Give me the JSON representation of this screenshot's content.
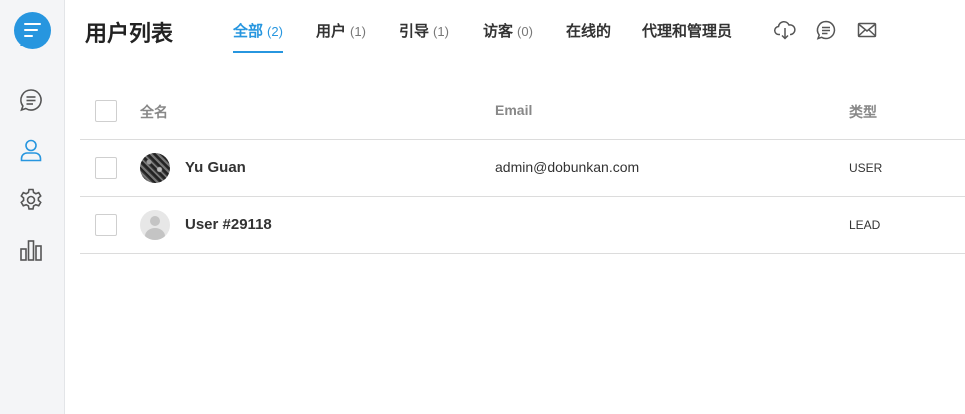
{
  "sidebar": {
    "logo": "chat-bubble-logo",
    "items": [
      {
        "name": "conversations",
        "icon": "chat-icon"
      },
      {
        "name": "users",
        "icon": "user-icon",
        "active": true
      },
      {
        "name": "settings",
        "icon": "gear-icon"
      },
      {
        "name": "reports",
        "icon": "bar-chart-icon"
      }
    ]
  },
  "header": {
    "title": "用户列表",
    "tabs": [
      {
        "label": "全部",
        "count": "(2)",
        "active": true
      },
      {
        "label": "用户",
        "count": "(1)"
      },
      {
        "label": "引导",
        "count": "(1)"
      },
      {
        "label": "访客",
        "count": "(0)"
      },
      {
        "label": "在线的",
        "count": ""
      },
      {
        "label": "代理和管理员",
        "count": ""
      }
    ],
    "actions": [
      {
        "name": "download",
        "icon": "cloud-download-icon"
      },
      {
        "name": "message",
        "icon": "chat-icon"
      },
      {
        "name": "email",
        "icon": "mail-icon"
      }
    ]
  },
  "table": {
    "columns": [
      "全名",
      "Email",
      "类型"
    ],
    "rows": [
      {
        "name": "Yu Guan",
        "email": "admin@dobunkan.com",
        "type": "USER",
        "avatar": "photo"
      },
      {
        "name": "User #29118",
        "email": "",
        "type": "LEAD",
        "avatar": "placeholder"
      }
    ]
  },
  "colors": {
    "accent": "#2796df",
    "icon": "#555555",
    "sidebar_bg": "#f4f5f7"
  }
}
